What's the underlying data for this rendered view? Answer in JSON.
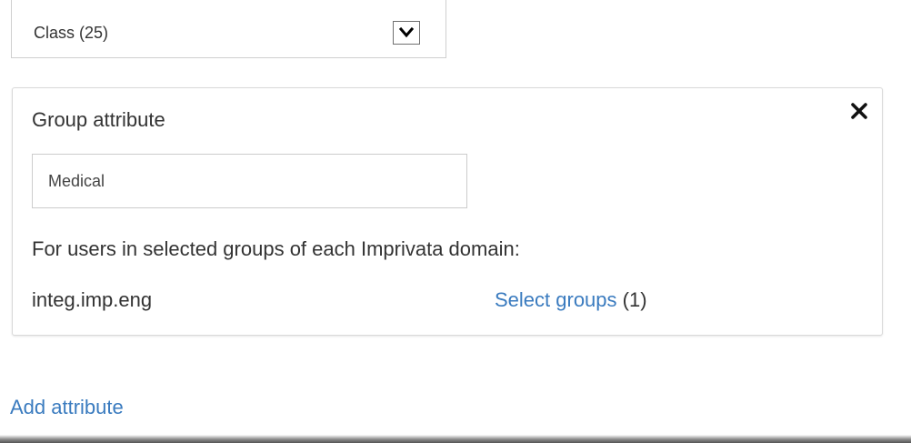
{
  "class_select": {
    "value": "Class (25)",
    "arrow_icon": "chevron-down-icon"
  },
  "group_panel": {
    "title": "Group attribute",
    "close_icon": "close-icon",
    "input_value": "Medical",
    "help_text": "For users in selected groups of each Imprivata domain:",
    "domain": "integ.imp.eng",
    "select_groups_label": "Select groups",
    "select_groups_count": "(1)"
  },
  "add_attribute_label": "Add attribute",
  "colors": {
    "link": "#3a7bbf",
    "text": "#333333",
    "border": "#d9d9d9"
  }
}
